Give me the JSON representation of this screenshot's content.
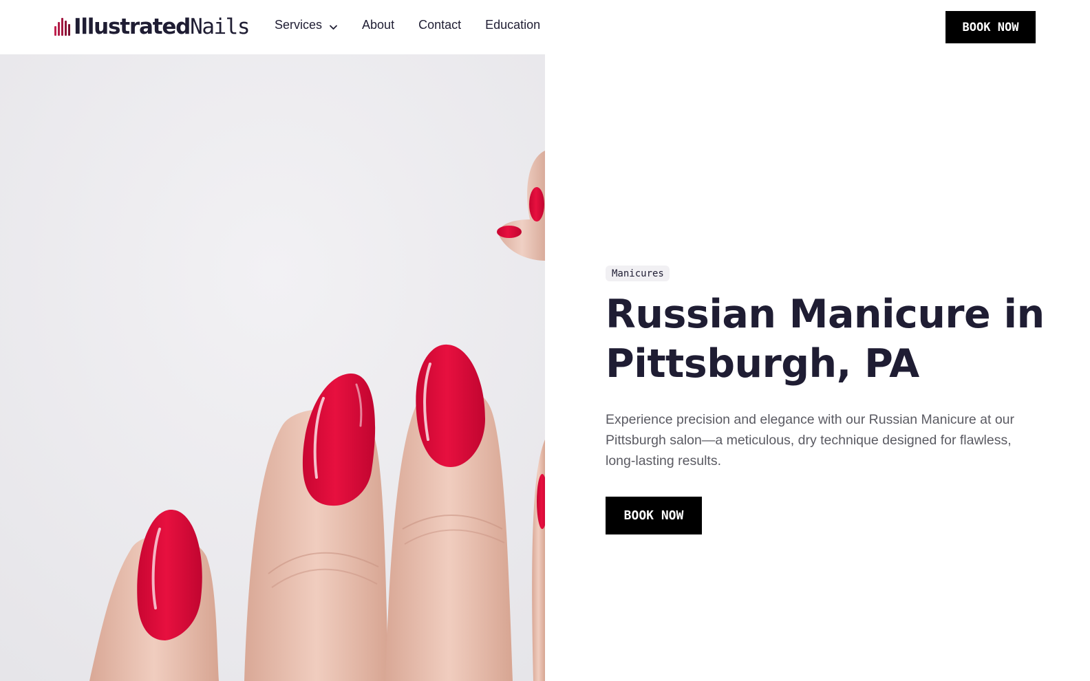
{
  "brand": {
    "name_bold": "Illustrated",
    "name_light": "Nails",
    "accent_color": "#a3163f"
  },
  "nav": {
    "items": [
      {
        "label": "Services",
        "has_dropdown": true,
        "icon": "chevron-down-icon"
      },
      {
        "label": "About"
      },
      {
        "label": "Contact"
      },
      {
        "label": "Education"
      }
    ]
  },
  "header": {
    "book_label": "BOOK NOW"
  },
  "hero": {
    "image_subject": "hand with glossy red almond-shaped manicured nails",
    "badge": "Manicures",
    "title": "Russian Manicure in Pittsburgh, PA",
    "description": "Experience precision and elegance with our Russian Manicure at our Pittsburgh salon—a meticulous, dry technique designed for flawless, long-lasting results.",
    "book_label": "BOOK NOW"
  },
  "colors": {
    "text_dark": "#1f1d33",
    "button_bg": "#000000",
    "button_text": "#ffffff",
    "nail_red": "#e10a3a",
    "image_bg": "#eeedf0"
  }
}
